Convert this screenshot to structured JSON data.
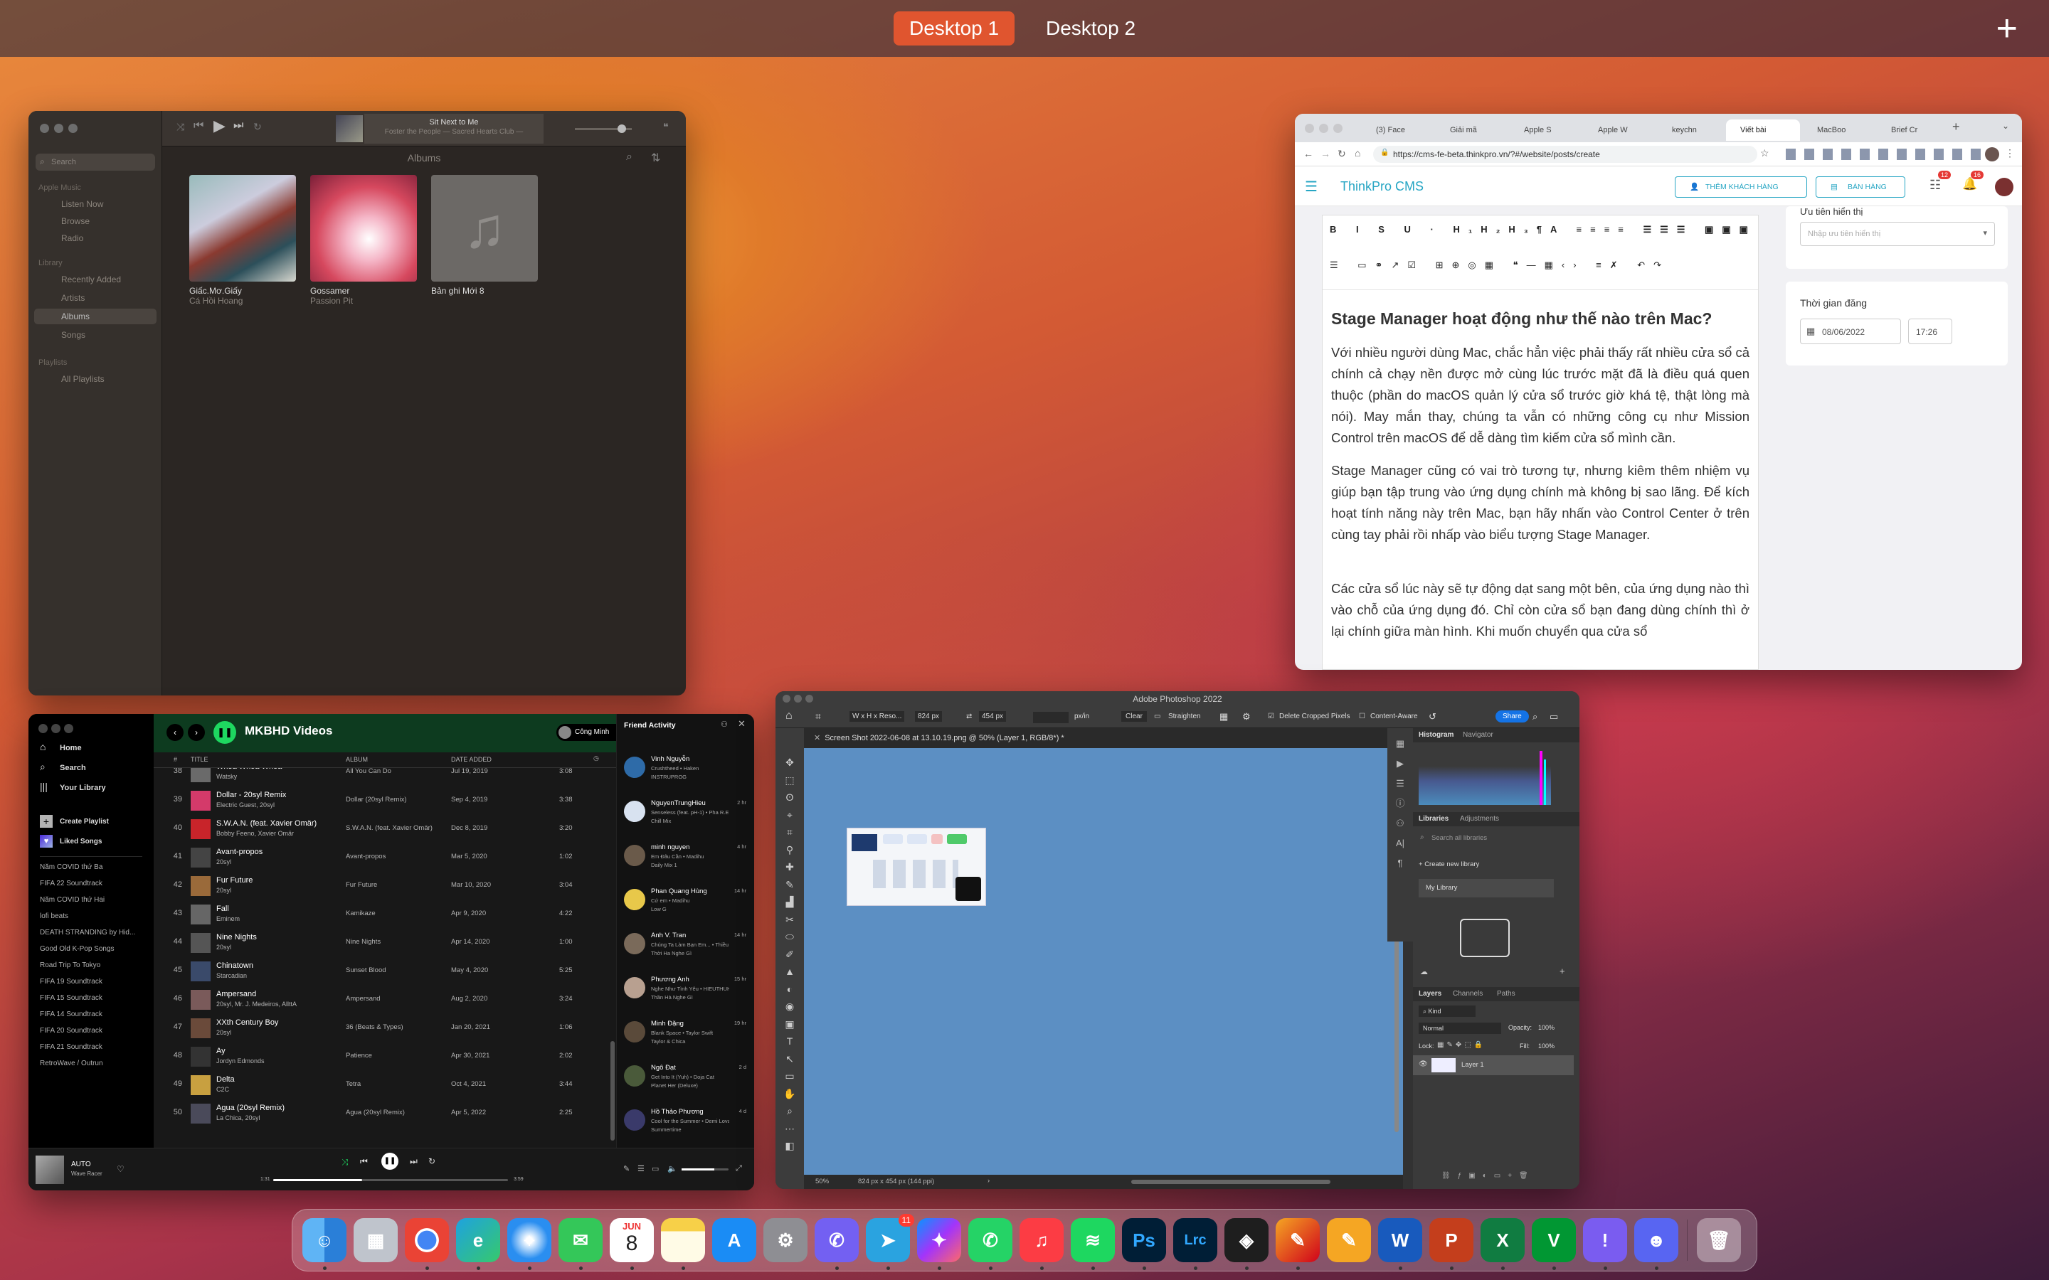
{
  "desktops": {
    "d1": "Desktop 1",
    "d2": "Desktop 2",
    "add": "+"
  },
  "music": {
    "now_playing_title": "Sit Next to Me",
    "now_playing_sub": "Foster the People — Sacred Hearts Club — ",
    "header": "Albums",
    "search_placeholder": "Search",
    "section_apple": "Apple Music",
    "listen_now": "Listen Now",
    "browse": "Browse",
    "radio": "Radio",
    "section_library": "Library",
    "recently_added": "Recently Added",
    "artists": "Artists",
    "albums": "Albums",
    "songs": "Songs",
    "section_playlists": "Playlists",
    "all_playlists": "All Playlists",
    "album_list": [
      {
        "title": "Giấc.Mơ.Giấy",
        "artist": "Cá Hồi Hoang"
      },
      {
        "title": "Gossamer",
        "artist": "Passion Pit"
      },
      {
        "title": "Bản ghi Mới 8",
        "artist": ""
      }
    ]
  },
  "browser": {
    "tabs": [
      "(3) Face",
      "Giải mã",
      "Apple S",
      "Apple W",
      "keychn",
      "Viết bài",
      "MacBoo",
      "Brief Cr"
    ],
    "url": "https://cms-fe-beta.thinkpro.vn/?#/website/posts/create",
    "cms_title": "ThinkPro CMS",
    "btn_customer": "THÊM KHÁCH HÀNG",
    "btn_sell": "BÁN HÀNG",
    "badge1": "12",
    "badge2": "16",
    "heading": "Stage Manager hoạt động như thế nào trên Mac?",
    "p1": "Với nhiều người dùng Mac, chắc hẳn việc phải thấy rất nhiều cửa sổ cả chính cả chạy nền được mở cùng lúc trước mặt đã là điều quá quen thuộc (phần do macOS quản lý cửa sổ trước giờ khá tệ, thật lòng mà nói). May mắn thay, chúng ta vẫn có những công cụ như Mission Control trên macOS để dễ dàng tìm kiếm cửa sổ mình cần.",
    "p2": "Stage Manager cũng có vai trò tương tự, nhưng kiêm thêm nhiệm vụ giúp bạn tập trung vào ứng dụng chính mà không bị sao lãng. Để kích hoạt tính năng này trên Mac, bạn hãy nhấn vào Control Center ở trên cùng tay phải rồi nhấp vào biểu tượng Stage Manager.",
    "p3": "Các cửa sổ lúc này sẽ tự động dạt sang một bên, của ứng dụng nào thì vào chỗ của ứng dụng đó. Chỉ còn cửa sổ bạn đang dùng chính thì ở lại chính giữa màn hình. Khi muốn chuyển qua cửa sổ",
    "priority_label": "Ưu tiên hiển thị",
    "priority_placeholder": "Nhập ưu tiên hiển thị",
    "time_label": "Thời gian đăng",
    "date": "08/06/2022",
    "time": "17:26"
  },
  "spotify": {
    "home": "Home",
    "search": "Search",
    "library": "Your Library",
    "create": "Create Playlist",
    "liked": "Liked Songs",
    "playlists": [
      "Năm COVID thứ Ba",
      "FIFA 22 Soundtrack",
      "Năm COVID thứ Hai",
      "lofi beats",
      "DEATH STRANDING by Hid...",
      "Good Old K-Pop Songs",
      "Road Trip To Tokyo",
      "FIFA 19 Soundtrack",
      "FIFA 15 Soundtrack",
      "FIFA 14 Soundtrack",
      "FIFA 20 Soundtrack",
      "FIFA 21 Soundtrack",
      "RetroWave / Outrun"
    ],
    "title": "MKBHD Videos",
    "user": "Công Minh",
    "col_num": "#",
    "col_title": "TITLE",
    "col_album": "ALBUM",
    "col_date": "DATE ADDED",
    "tracks": [
      {
        "n": "38",
        "title": "Whoa Whoa Whoa",
        "artist": "Watsky",
        "album": "All You Can Do",
        "date": "Jul 19, 2019",
        "dur": "3:08"
      },
      {
        "n": "39",
        "title": "Dollar - 20syl Remix",
        "artist": "Electric Guest, 20syl",
        "album": "Dollar (20syl Remix)",
        "date": "Sep 4, 2019",
        "dur": "3:38"
      },
      {
        "n": "40",
        "title": "S.W.A.N. (feat. Xavier Omär)",
        "artist": "Bobby Feeno, Xavier Omär",
        "album": "S.W.A.N. (feat. Xavier Omär)",
        "date": "Dec 8, 2019",
        "dur": "3:20"
      },
      {
        "n": "41",
        "title": "Avant-propos",
        "artist": "20syl",
        "album": "Avant-propos",
        "date": "Mar 5, 2020",
        "dur": "1:02"
      },
      {
        "n": "42",
        "title": "Fur Future",
        "artist": "20syl",
        "album": "Fur Future",
        "date": "Mar 10, 2020",
        "dur": "3:04"
      },
      {
        "n": "43",
        "title": "Fall",
        "artist": "Eminem",
        "album": "Kamikaze",
        "date": "Apr 9, 2020",
        "dur": "4:22"
      },
      {
        "n": "44",
        "title": "Nine Nights",
        "artist": "20syl",
        "album": "Nine Nights",
        "date": "Apr 14, 2020",
        "dur": "1:00"
      },
      {
        "n": "45",
        "title": "Chinatown",
        "artist": "Starcadian",
        "album": "Sunset Blood",
        "date": "May 4, 2020",
        "dur": "5:25"
      },
      {
        "n": "46",
        "title": "Ampersand",
        "artist": "20syl, Mr. J. Medeiros, AllttA",
        "album": "Ampersand",
        "date": "Aug 2, 2020",
        "dur": "3:24"
      },
      {
        "n": "47",
        "title": "XXth Century Boy",
        "artist": "20syl",
        "album": "36 (Beats & Types)",
        "date": "Jan 20, 2021",
        "dur": "1:06"
      },
      {
        "n": "48",
        "title": "Ay",
        "artist": "Jordyn Edmonds",
        "album": "Patience",
        "date": "Apr 30, 2021",
        "dur": "2:02"
      },
      {
        "n": "49",
        "title": "Delta",
        "artist": "C2C",
        "album": "Tetra",
        "date": "Oct 4, 2021",
        "dur": "3:44"
      },
      {
        "n": "50",
        "title": "Agua (20syl Remix)",
        "artist": "La Chica, 20syl",
        "album": "Agua (20syl Remix)",
        "date": "Apr 5, 2022",
        "dur": "2:25"
      }
    ],
    "friends_title": "Friend Activity",
    "friends": [
      {
        "name": "Vinh Nguyễn",
        "l1": "Crushtheed • Haken",
        "l2": "INSTRUPROG",
        "time": ""
      },
      {
        "name": "NguyenTrungHieu",
        "l1": "Senseless (feat. pH-1) • Pha R.E.D.S",
        "l2": "Chill Mix",
        "time": "2 hr"
      },
      {
        "name": "minh nguyen",
        "l1": "Em Đâu Cần • Madihu",
        "l2": "Daily Mix 1",
        "time": "4 hr"
      },
      {
        "name": "Phan Quang Hùng",
        "l1": "Cứ em • Madihu",
        "l2": "Low G",
        "time": "14 hr"
      },
      {
        "name": "Anh V. Tran",
        "l1": "Chúng Ta Làm Bạn Em... • Thiều Bả",
        "l2": "Thời Ha Nghe Gì",
        "time": "14 hr"
      },
      {
        "name": "Phương Anh",
        "l1": "Nghe Như Tình Yêu • HIEUTHUHAI",
        "l2": "Thần Hà Nghe Gì",
        "time": "15 hr"
      },
      {
        "name": "Minh Đặng",
        "l1": "Blank Space • Taylor Swift",
        "l2": "Taylor & Chica",
        "time": "19 hr"
      },
      {
        "name": "Ngô Đạt",
        "l1": "Get Into It (Yuh) • Doja Cat",
        "l2": "Planet Her (Deluxe)",
        "time": "2 d"
      },
      {
        "name": "Hồ Thảo Phương",
        "l1": "Cool for the Summer • Demi Lovato",
        "l2": "Summertime",
        "time": "4 d"
      }
    ],
    "now_title": "AUTO",
    "now_artist": "Wave Racer",
    "time_cur": "1:31",
    "time_total": "3:59"
  },
  "photoshop": {
    "title": "Adobe Photoshop 2022",
    "doc": "Screen Shot 2022-06-08 at 13.10.19.png @ 50% (Layer 1, RGB/8*) *",
    "opt_ratio": "W x H x Reso...",
    "opt_w": "824 px",
    "opt_h": "454 px",
    "opt_unit": "px/in",
    "clear": "Clear",
    "straighten": "Straighten",
    "delete_cropped": "Delete Cropped Pixels",
    "content_aware": "Content-Aware",
    "share": "Share",
    "histogram": "Histogram",
    "navigator": "Navigator",
    "libraries": "Libraries",
    "adjustments": "Adjustments",
    "search_libs": "Search all libraries",
    "create_lib": "Create new library",
    "my_lib": "My Library",
    "layers": "Layers",
    "channels": "Channels",
    "paths": "Paths",
    "kind": "Kind",
    "normal": "Normal",
    "opacity": "Opacity:",
    "opacity_v": "100%",
    "lock": "Lock:",
    "fill": "Fill:",
    "fill_v": "100%",
    "layer1": "Layer 1",
    "zoom": "50%",
    "status": "824 px x 454 px (144 ppi)"
  },
  "dock": {
    "calendar_month": "JUN",
    "calendar_day": "8",
    "telegram_badge": "11",
    "items": [
      "finder",
      "launchpad",
      "chrome",
      "edge",
      "safari",
      "messages",
      "calendar",
      "notes",
      "app-store",
      "system-preferences",
      "viber",
      "telegram",
      "messenger",
      "whatsapp",
      "music",
      "spotify",
      "photoshop",
      "lightroom",
      "figma",
      "pixelmator",
      "pages",
      "word",
      "powerpoint",
      "excel",
      "vim",
      "feedback",
      "discord",
      "trash"
    ]
  }
}
